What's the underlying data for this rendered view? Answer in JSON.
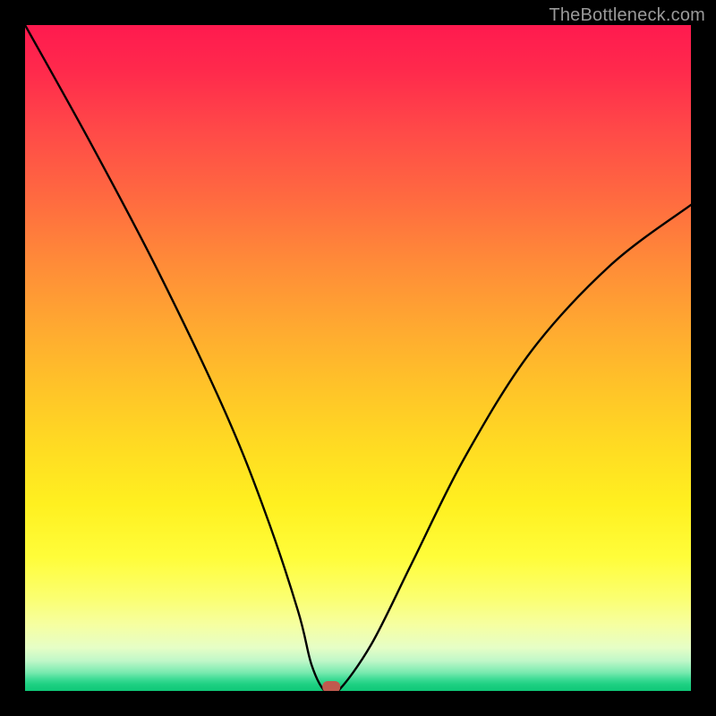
{
  "watermark": "TheBottleneck.com",
  "chart_data": {
    "type": "line",
    "title": "",
    "xlabel": "",
    "ylabel": "",
    "xlim": [
      0,
      100
    ],
    "ylim": [
      0,
      100
    ],
    "grid": false,
    "legend": false,
    "background_gradient": {
      "direction": "vertical",
      "stops": [
        {
          "pos": 0.0,
          "color": "#ff1a4f",
          "meaning": "worst"
        },
        {
          "pos": 0.5,
          "color": "#ffc528",
          "meaning": "mid"
        },
        {
          "pos": 0.8,
          "color": "#fffd3a",
          "meaning": "near-optimal"
        },
        {
          "pos": 1.0,
          "color": "#0fc778",
          "meaning": "optimal"
        }
      ]
    },
    "series": [
      {
        "name": "bottleneck-curve",
        "x": [
          0,
          10,
          20,
          30,
          36,
          41,
          43,
          45,
          47,
          52,
          58,
          66,
          76,
          88,
          100
        ],
        "values": [
          100,
          82,
          63,
          42,
          27,
          12,
          4,
          0,
          0,
          7,
          19,
          35,
          51,
          64,
          73
        ]
      }
    ],
    "marker": {
      "name": "selected-point",
      "x": 46,
      "y": 0,
      "color": "#c05a4e",
      "shape": "rounded-rect"
    }
  }
}
